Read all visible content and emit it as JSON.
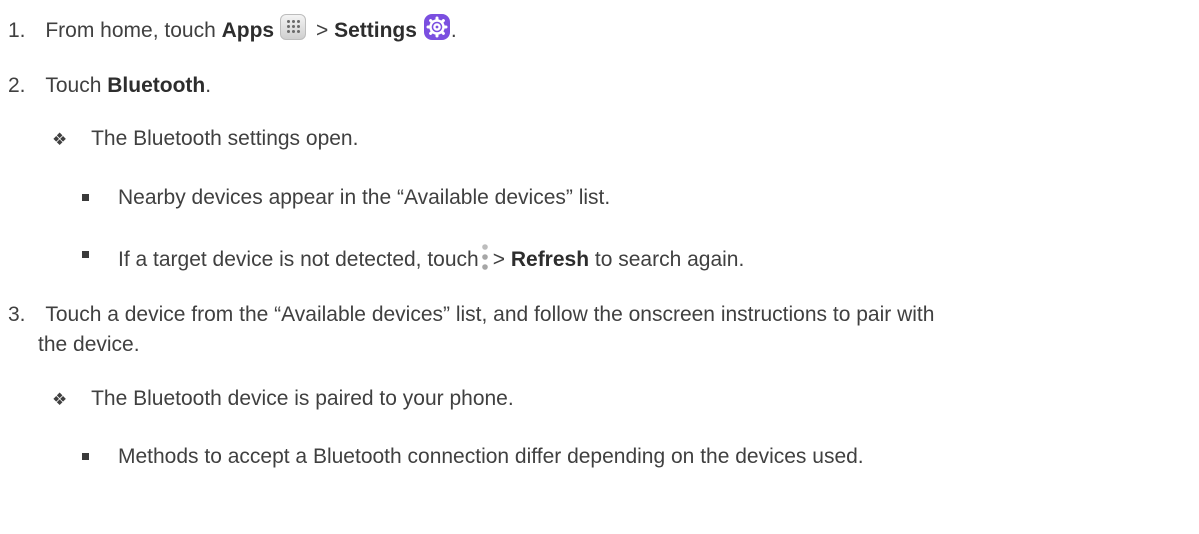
{
  "step1": {
    "number": "1.",
    "prefix": "From home, touch",
    "apps": "Apps",
    "sep": ">",
    "settings": "Settings",
    "end": "."
  },
  "step2": {
    "number": "2.",
    "prefix": "Touch",
    "bluetooth": "Bluetooth",
    "end": "."
  },
  "result1": {
    "bullet": "❖",
    "text": "The Bluetooth settings open."
  },
  "sub1": {
    "text_before": "Nearby devices appear in the “Available devices” list."
  },
  "sub2": {
    "prefix": "If a target device is not detected, touch",
    "sep": ">",
    "refresh": "Refresh",
    "suffix": " to search again."
  },
  "step3": {
    "number": "3.",
    "line1": "Touch a device from the “Available devices” list, and follow the onscreen instructions to pair with",
    "line2": "the device."
  },
  "result2": {
    "bullet": "❖",
    "text": "The Bluetooth device is paired to your phone."
  },
  "sub3": {
    "text": "Methods to accept a Bluetooth connection differ depending on the devices used."
  },
  "icons": {
    "apps": "apps-grid-icon",
    "settings": "settings-gear-icon",
    "more": "more-options-icon"
  },
  "colors": {
    "settings_icon": "#7b4fe0",
    "text": "#404040"
  }
}
